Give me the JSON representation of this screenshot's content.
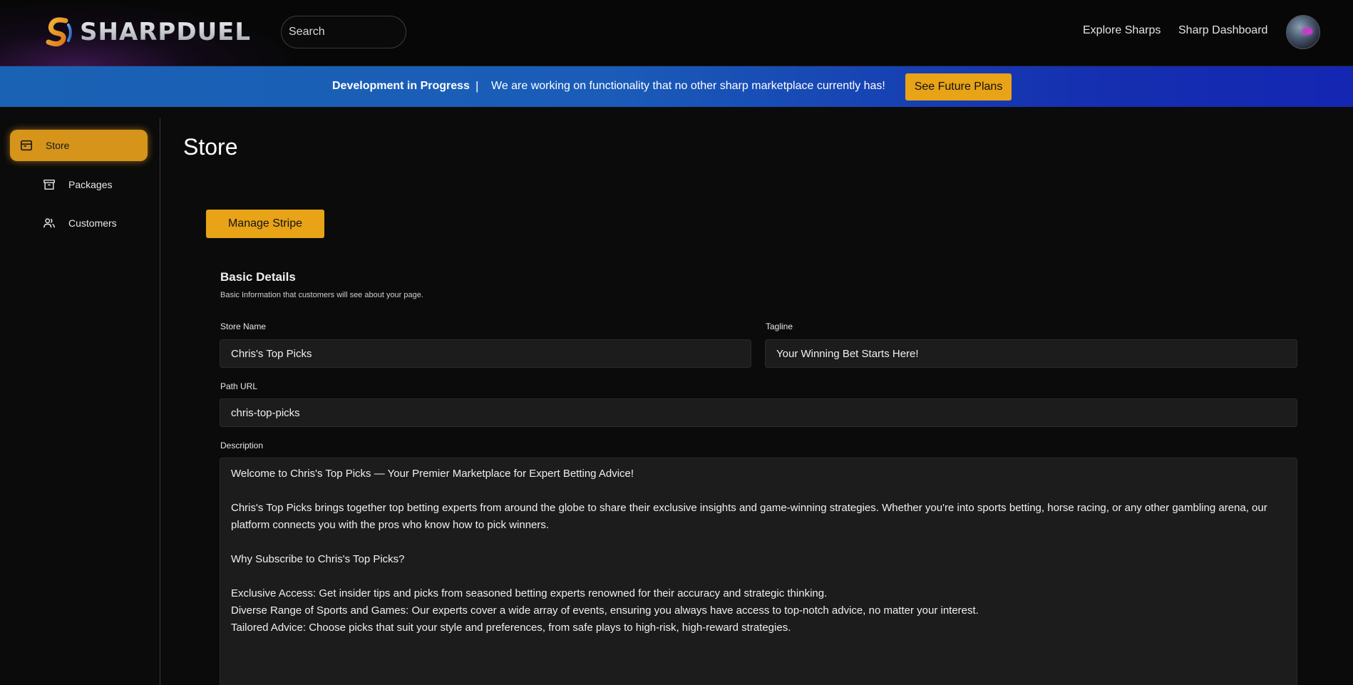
{
  "header": {
    "logo_text": "SHARPDUEL",
    "search_placeholder": "Search",
    "nav": {
      "explore": "Explore Sharps",
      "dashboard": "Sharp Dashboard"
    }
  },
  "banner": {
    "title": "Development in Progress",
    "separator": "|",
    "message": "We are working on functionality that no other sharp marketplace currently has!",
    "button": "See Future Plans"
  },
  "sidebar": {
    "items": [
      {
        "label": "Store",
        "icon": "store-icon",
        "active": true
      },
      {
        "label": "Packages",
        "icon": "archive-box-icon",
        "active": false
      },
      {
        "label": "Customers",
        "icon": "users-icon",
        "active": false
      }
    ]
  },
  "main": {
    "title": "Store",
    "manage_stripe": "Manage Stripe",
    "basic_details": {
      "title": "Basic Details",
      "subtitle": "Basic Information that customers will see about your page."
    },
    "fields": {
      "store_name": {
        "label": "Store Name",
        "value": "Chris's Top Picks"
      },
      "tagline": {
        "label": "Tagline",
        "value": "Your Winning Bet Starts Here!"
      },
      "path_url": {
        "label": "Path URL",
        "value": "chris-top-picks"
      },
      "description": {
        "label": "Description",
        "paragraphs": [
          "Welcome to Chris's Top Picks — Your Premier Marketplace for Expert Betting Advice!",
          "Chris's Top Picks brings together top betting experts from around the globe to share their exclusive insights and game-winning strategies. Whether you're into sports betting, horse racing, or any other gambling arena, our platform connects you with the pros who know how to pick winners.",
          "Why Subscribe to Chris's Top Picks?",
          "Exclusive Access: Get insider tips and picks from seasoned betting experts renowned for their accuracy and strategic thinking.",
          "Diverse Range of Sports and Games: Our experts cover a wide array of events, ensuring you always have access to top-notch advice, no matter your interest.",
          "Tailored Advice: Choose picks that suit your style and preferences, from safe plays to high-risk, high-reward strategies."
        ]
      }
    }
  },
  "colors": {
    "accent": "#e8a317",
    "banner_start": "#1a62b4",
    "banner_end": "#1426b2",
    "background": "#0b0b0b",
    "field_bg": "#1c1c1c"
  }
}
